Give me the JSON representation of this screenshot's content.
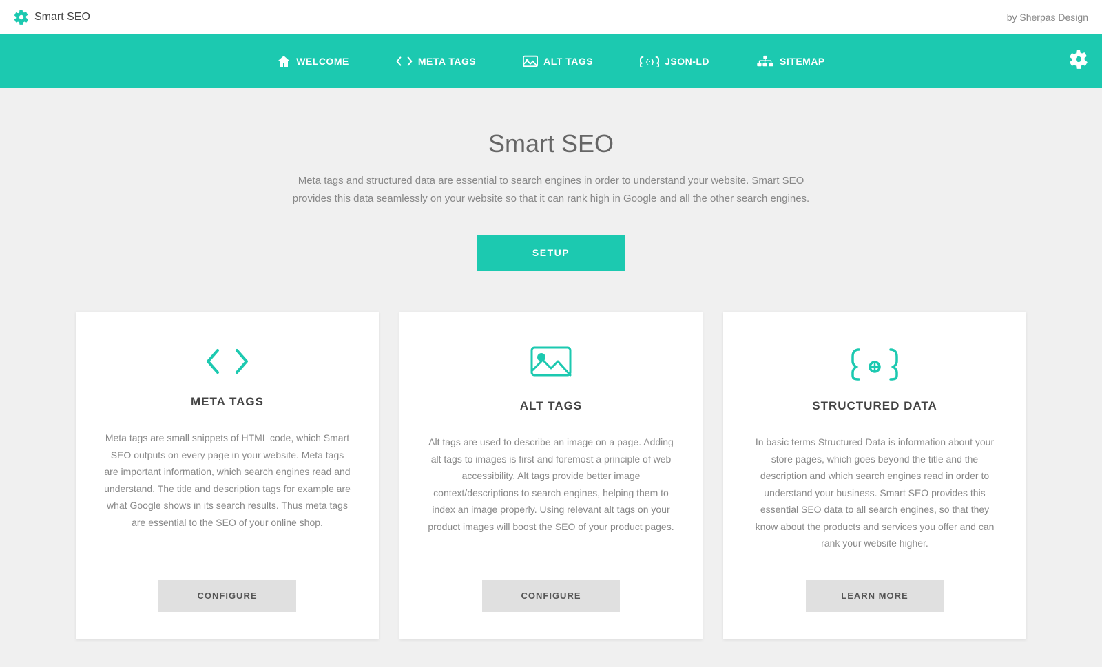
{
  "app": {
    "name": "Smart SEO",
    "byline": "by Sherpas Design"
  },
  "nav": {
    "items": [
      {
        "id": "welcome",
        "label": "WELCOME",
        "icon": "home-icon",
        "active": true
      },
      {
        "id": "meta-tags",
        "label": "META TAGS",
        "icon": "code-icon",
        "active": false
      },
      {
        "id": "alt-tags",
        "label": "ALT TAGS",
        "icon": "image-icon",
        "active": false
      },
      {
        "id": "json-ld",
        "label": "JSON-LD",
        "icon": "json-icon",
        "active": false
      },
      {
        "id": "sitemap",
        "label": "SITEMAP",
        "icon": "sitemap-icon",
        "active": false
      }
    ],
    "settings_icon": "gear-icon"
  },
  "main": {
    "title": "Smart SEO",
    "subtitle": "Meta tags and structured data are essential to search engines in order to understand your website. Smart SEO provides this data seamlessly on your website so that it can rank high in Google and all the other search engines.",
    "setup_button": "SETUP"
  },
  "cards": [
    {
      "id": "meta-tags",
      "icon": "code-icon",
      "title": "META TAGS",
      "description": "Meta tags are small snippets of HTML code, which Smart SEO outputs on every page in your website. Meta tags are important information, which search engines read and understand. The title and description tags for example are what Google shows in its search results. Thus meta tags are essential to the SEO of your online shop.",
      "button": "CONFIGURE"
    },
    {
      "id": "alt-tags",
      "icon": "image-icon",
      "title": "ALT TAGS",
      "description": "Alt tags are used to describe an image on a page. Adding alt tags to images is first and foremost a principle of web accessibility. Alt tags provide better image context/descriptions to search engines, helping them to index an image properly. Using relevant alt tags on your product images will boost the SEO of your product pages.",
      "button": "CONFIGURE"
    },
    {
      "id": "structured-data",
      "icon": "structured-icon",
      "title": "STRUCTURED DATA",
      "description": "In basic terms Structured Data is information about your store pages, which goes beyond the title and the description and which search engines read in order to understand your business. Smart SEO provides this essential SEO data to all search engines, so that they know about the products and services you offer and can rank your website higher.",
      "button": "LEARN MORE"
    }
  ],
  "colors": {
    "teal": "#1cc9b0",
    "teal_dark": "#18b59e",
    "text_dark": "#444",
    "text_mid": "#666",
    "text_light": "#888",
    "btn_gray": "#e0e0e0",
    "bg": "#f0f0f0"
  }
}
